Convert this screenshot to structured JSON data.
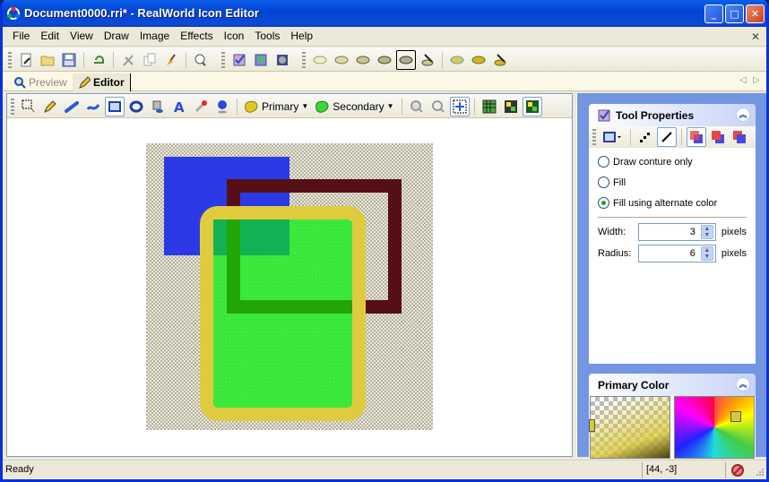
{
  "window": {
    "title": "Document0000.rri* - RealWorld Icon Editor",
    "app_icon": "realworld-app-icon",
    "controls": {
      "minimize": "_",
      "maximize": "□",
      "close": "✕"
    }
  },
  "menubar": {
    "items": [
      "File",
      "Edit",
      "View",
      "Draw",
      "Image",
      "Effects",
      "Icon",
      "Tools",
      "Help"
    ],
    "mdi_close": "✕"
  },
  "main_toolbar": {
    "groups": [
      [
        "new-document-icon",
        "open-folder-icon",
        "save-icon"
      ],
      [
        "undo-icon"
      ],
      [
        "cut-icon",
        "copy-icon",
        "paste-brush-icon"
      ],
      [
        "bulb-icon"
      ],
      [
        "checkbox-icon",
        "zoom-preview-icon",
        "frame-icon"
      ],
      [
        "layer-style-1-icon",
        "layer-style-2-icon",
        "layer-style-3-icon",
        "layer-style-4-icon",
        "layer-style-5-icon",
        "layer-style-edit-icon"
      ],
      [
        "layer-color-1-icon",
        "layer-color-2-icon",
        "layer-color-edit-icon"
      ]
    ]
  },
  "tabs": {
    "items": [
      {
        "label": "Preview",
        "icon": "magnifier-icon",
        "active": false
      },
      {
        "label": "Editor",
        "icon": "pencil-icon",
        "active": true
      }
    ],
    "nav_prev": "◁",
    "nav_next": "▷"
  },
  "editor_toolbar": {
    "tools": [
      "selection-tool",
      "pencil-tool",
      "line-tool",
      "curve-tool",
      "rectangle-tool",
      "ellipse-tool",
      "fill-tool",
      "text-tool",
      "eraser-tool",
      "color-picker-tool"
    ],
    "active_tool": "rectangle-tool",
    "primary_label": "Primary",
    "secondary_label": "Secondary",
    "view_buttons": [
      "zoom-in-icon",
      "zoom-out-icon",
      "fit-icon",
      "grid-icon",
      "background-1-icon",
      "background-2-icon"
    ]
  },
  "canvas": {
    "colors": {
      "blue": "#2b3ae6",
      "dark_red": "#560f15",
      "yellow": "#dfcc3e",
      "green": "#3deb3d",
      "dark_green": "#22a506",
      "teal": "#12b255"
    }
  },
  "tool_properties": {
    "title": "Tool Properties",
    "options": [
      {
        "label": "Draw conture only",
        "checked": false
      },
      {
        "label": "Fill",
        "checked": false
      },
      {
        "label": "Fill using alternate color",
        "checked": true
      }
    ],
    "width_label": "Width:",
    "width_value": "3",
    "radius_label": "Radius:",
    "radius_value": "6",
    "unit": "pixels"
  },
  "primary_color": {
    "title": "Primary Color",
    "color": "#d9c838"
  },
  "statusbar": {
    "status": "Ready",
    "coords": "[44, -3]"
  }
}
